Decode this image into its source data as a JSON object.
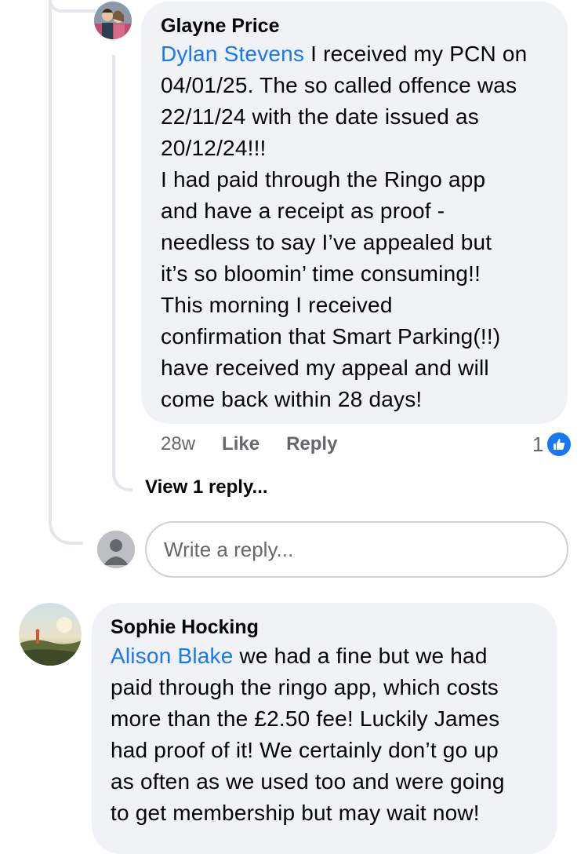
{
  "comment1": {
    "author": "Glayne Price",
    "mention": "Dylan Stevens",
    "lines": [
      " I received my PCN on",
      "04/01/25. The so called offence was",
      "22/11/24 with the date issued as",
      "20/12/24!!!",
      "I had paid through the Ringo app",
      "and have a receipt as proof -",
      "needless to say I’ve appealed but",
      "it’s so bloomin’ time consuming!!",
      "This morning I received",
      "confirmation that Smart Parking(!!)",
      "have received my appeal and will",
      "come back within 28 days!"
    ],
    "time": "28w",
    "like_label": "Like",
    "reply_label": "Reply",
    "reaction_count": "1",
    "view_replies": "View 1 reply..."
  },
  "reply_box": {
    "placeholder": "Write a reply..."
  },
  "comment2": {
    "author": "Sophie Hocking",
    "mention": "Alison Blake",
    "lines": [
      " we had a fine but we had",
      "paid through the ringo app, which costs",
      "more than the £2.50 fee! Luckily James",
      "had proof of it! We certainly don’t go up",
      "as often as we used too and were going",
      "to get membership but may wait now!"
    ]
  },
  "colors": {
    "mention": "#1877f2",
    "bubble": "#f0f2f5",
    "secondary_text": "#65676b",
    "like_badge": "#1877f2"
  }
}
